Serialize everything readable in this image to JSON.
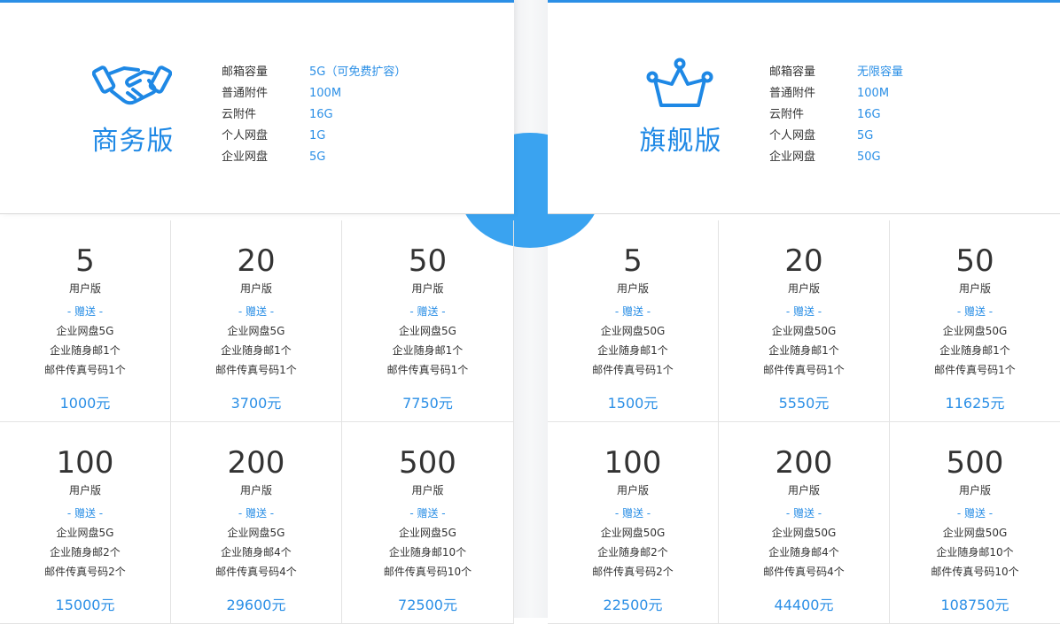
{
  "colors": {
    "accent": "#2b8fe6",
    "title_blue": "#1e88e5",
    "circle": "#3aa3f0"
  },
  "plans": [
    {
      "icon": "handshake-icon",
      "name": "商务版",
      "specs": [
        {
          "label": "邮箱容量",
          "value": "5G（可免费扩容）"
        },
        {
          "label": "普通附件",
          "value": "100M"
        },
        {
          "label": "云附件",
          "value": "16G"
        },
        {
          "label": "个人网盘",
          "value": "1G"
        },
        {
          "label": "企业网盘",
          "value": "5G"
        }
      ],
      "tiers": [
        {
          "count": "5",
          "edition": "用户版",
          "gift": "- 赠送 -",
          "lines": [
            "企业网盘5G",
            "企业随身邮1个",
            "邮件传真号码1个"
          ],
          "price": "1000元"
        },
        {
          "count": "20",
          "edition": "用户版",
          "gift": "- 赠送 -",
          "lines": [
            "企业网盘5G",
            "企业随身邮1个",
            "邮件传真号码1个"
          ],
          "price": "3700元"
        },
        {
          "count": "50",
          "edition": "用户版",
          "gift": "- 赠送 -",
          "lines": [
            "企业网盘5G",
            "企业随身邮1个",
            "邮件传真号码1个"
          ],
          "price": "7750元"
        },
        {
          "count": "100",
          "edition": "用户版",
          "gift": "- 赠送 -",
          "lines": [
            "企业网盘5G",
            "企业随身邮2个",
            "邮件传真号码2个"
          ],
          "price": "15000元"
        },
        {
          "count": "200",
          "edition": "用户版",
          "gift": "- 赠送 -",
          "lines": [
            "企业网盘5G",
            "企业随身邮4个",
            "邮件传真号码4个"
          ],
          "price": "29600元"
        },
        {
          "count": "500",
          "edition": "用户版",
          "gift": "- 赠送 -",
          "lines": [
            "企业网盘5G",
            "企业随身邮10个",
            "邮件传真号码10个"
          ],
          "price": "72500元"
        }
      ]
    },
    {
      "icon": "crown-icon",
      "name": "旗舰版",
      "specs": [
        {
          "label": "邮箱容量",
          "value": "无限容量"
        },
        {
          "label": "普通附件",
          "value": "100M"
        },
        {
          "label": "云附件",
          "value": "16G"
        },
        {
          "label": "个人网盘",
          "value": "5G"
        },
        {
          "label": "企业网盘",
          "value": "50G"
        }
      ],
      "tiers": [
        {
          "count": "5",
          "edition": "用户版",
          "gift": "- 赠送 -",
          "lines": [
            "企业网盘50G",
            "企业随身邮1个",
            "邮件传真号码1个"
          ],
          "price": "1500元"
        },
        {
          "count": "20",
          "edition": "用户版",
          "gift": "- 赠送 -",
          "lines": [
            "企业网盘50G",
            "企业随身邮1个",
            "邮件传真号码1个"
          ],
          "price": "5550元"
        },
        {
          "count": "50",
          "edition": "用户版",
          "gift": "- 赠送 -",
          "lines": [
            "企业网盘50G",
            "企业随身邮1个",
            "邮件传真号码1个"
          ],
          "price": "11625元"
        },
        {
          "count": "100",
          "edition": "用户版",
          "gift": "- 赠送 -",
          "lines": [
            "企业网盘50G",
            "企业随身邮2个",
            "邮件传真号码2个"
          ],
          "price": "22500元"
        },
        {
          "count": "200",
          "edition": "用户版",
          "gift": "- 赠送 -",
          "lines": [
            "企业网盘50G",
            "企业随身邮4个",
            "邮件传真号码4个"
          ],
          "price": "44400元"
        },
        {
          "count": "500",
          "edition": "用户版",
          "gift": "- 赠送 -",
          "lines": [
            "企业网盘50G",
            "企业随身邮10个",
            "邮件传真号码10个"
          ],
          "price": "108750元"
        }
      ]
    }
  ]
}
